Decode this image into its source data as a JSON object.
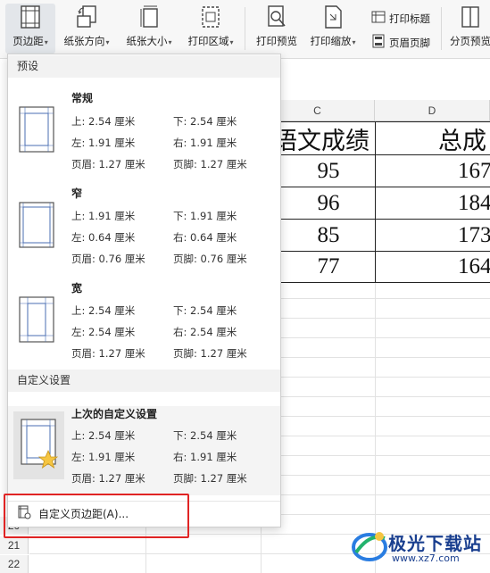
{
  "ribbon": {
    "margins": "页边距",
    "orientation": "纸张方向",
    "size": "纸张大小",
    "print_area": "打印区域",
    "print_preview": "打印预览",
    "print_scale": "打印缩放",
    "print_titles": "打印标题",
    "header_footer": "页眉页脚",
    "page_break_preview": "分页预览"
  },
  "sheet": {
    "col_c": "C",
    "col_d": "D",
    "header_c": "语文成绩",
    "header_d": "总成",
    "rows": [
      {
        "c": "95",
        "d": "167"
      },
      {
        "c": "96",
        "d": "184"
      },
      {
        "c": "85",
        "d": "173"
      },
      {
        "c": "77",
        "d": "164"
      }
    ],
    "row_numbers": [
      "20",
      "21",
      "22"
    ]
  },
  "dropdown": {
    "presets_header": "预设",
    "presets": [
      {
        "name": "常规",
        "top": "上: 2.54 厘米",
        "bottom": "下: 2.54 厘米",
        "left": "左: 1.91 厘米",
        "right": "右: 1.91 厘米",
        "header": "页眉: 1.27 厘米",
        "footer": "页脚: 1.27 厘米"
      },
      {
        "name": "窄",
        "top": "上: 1.91 厘米",
        "bottom": "下: 1.91 厘米",
        "left": "左: 0.64 厘米",
        "right": "右: 0.64 厘米",
        "header": "页眉: 0.76 厘米",
        "footer": "页脚: 0.76 厘米"
      },
      {
        "name": "宽",
        "top": "上: 2.54 厘米",
        "bottom": "下: 2.54 厘米",
        "left": "左: 2.54 厘米",
        "right": "右: 2.54 厘米",
        "header": "页眉: 1.27 厘米",
        "footer": "页脚: 1.27 厘米"
      }
    ],
    "custom_header": "自定义设置",
    "last_custom": {
      "name": "上次的自定义设置",
      "top": "上: 2.54 厘米",
      "bottom": "下: 2.54 厘米",
      "left": "左: 1.91 厘米",
      "right": "右: 1.91 厘米",
      "header": "页眉: 1.27 厘米",
      "footer": "页脚: 1.27 厘米"
    },
    "custom_margins_label": "自定义页边距(A)..."
  },
  "watermark": {
    "brand": "极光下载站",
    "url": "www.xz7.com"
  },
  "colors": {
    "highlight_red": "#e02424",
    "icon_blue": "#4a6fb3",
    "star_yellow": "#f5c542"
  }
}
